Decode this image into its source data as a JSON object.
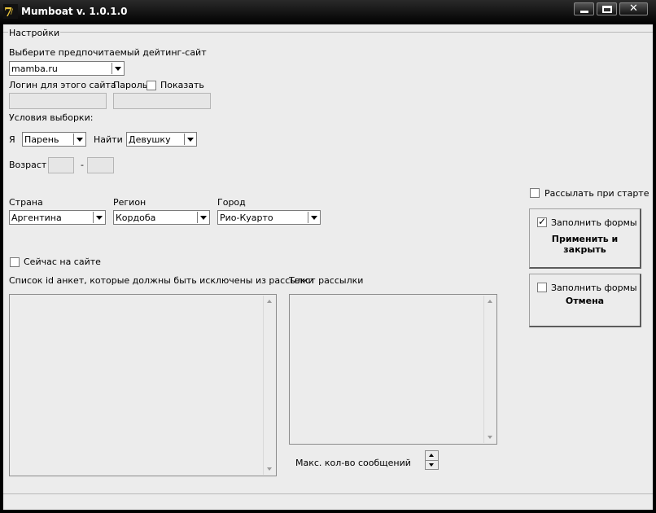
{
  "window": {
    "title": "Mumboat v. 1.0.1.0",
    "icon": "app-logo-icon",
    "close_glyph": "✕"
  },
  "settings": {
    "group_title": "Настройки",
    "site_label": "Выберите предпочитаемый дейтинг-сайт",
    "site_value": "mamba.ru",
    "login_label": "Логин для этого сайта",
    "login_value": "",
    "password_label": "Пароль",
    "show_label": "Показать",
    "conditions_label": "Условия выборки:",
    "i_label": "Я",
    "i_value": "Парень",
    "find_label": "Найти",
    "find_value": "Девушку",
    "age_label": "Возраст",
    "age_from": "",
    "age_dash": "-",
    "age_to": "",
    "country_label": "Страна",
    "country_value": "Аргентина",
    "region_label": "Регион",
    "region_value": "Кордоба",
    "city_label": "Город",
    "city_value": "Рио-Куарто",
    "online_label": "Сейчас на сайте",
    "exclude_label": "Список id анкет, которые должны быть исключены из рассылки",
    "message_label": "Текст рассылки",
    "max_messages_label": "Макс. кол-во сообщений"
  },
  "side": {
    "send_on_start_label": "Рассылать при старте",
    "apply_fill_label": "Заполнить формы",
    "apply_fill_checked": true,
    "apply_button": "Применить и закрыть",
    "cancel_fill_label": "Заполнить формы",
    "cancel_fill_checked": false,
    "cancel_button": "Отмена"
  }
}
